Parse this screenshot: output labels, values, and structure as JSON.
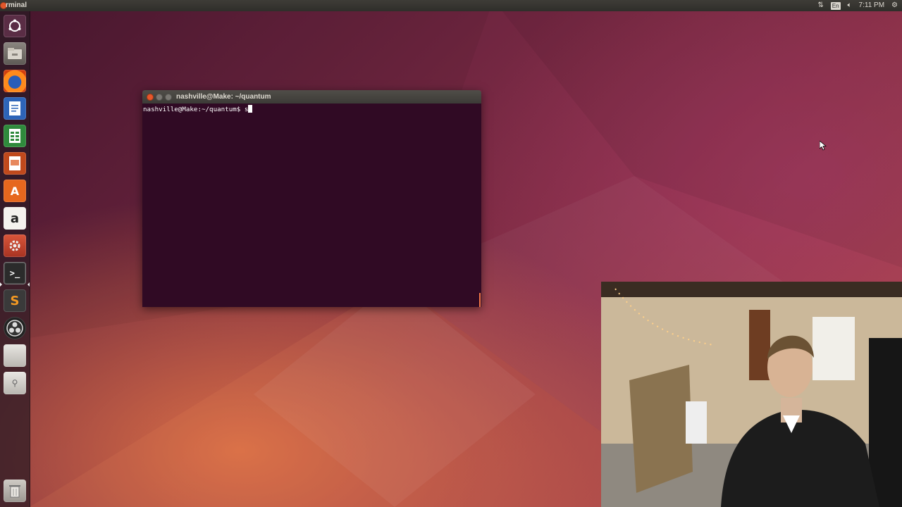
{
  "topbar": {
    "app_title": "rminal",
    "keyboard_lang": "En",
    "clock": "7:11 PM"
  },
  "launcher": {
    "items": [
      {
        "name": "dash-home-icon",
        "glyph": ""
      },
      {
        "name": "files-icon",
        "glyph": ""
      },
      {
        "name": "firefox-icon",
        "glyph": ""
      },
      {
        "name": "libreoffice-writer-icon",
        "glyph": ""
      },
      {
        "name": "libreoffice-calc-icon",
        "glyph": ""
      },
      {
        "name": "libreoffice-impress-icon",
        "glyph": ""
      },
      {
        "name": "software-center-icon",
        "glyph": "A"
      },
      {
        "name": "amazon-icon",
        "glyph": "a"
      },
      {
        "name": "system-settings-icon",
        "glyph": ""
      },
      {
        "name": "terminal-icon",
        "glyph": ">_"
      },
      {
        "name": "sublime-text-icon",
        "glyph": "S"
      },
      {
        "name": "obs-studio-icon",
        "glyph": ""
      },
      {
        "name": "drive-icon",
        "glyph": ""
      },
      {
        "name": "usb-drive-icon",
        "glyph": ""
      },
      {
        "name": "trash-icon",
        "glyph": ""
      }
    ]
  },
  "terminal": {
    "title": "nashville@Make: ~/quantum",
    "prompt": "nashville@Make:~/quantum$ ",
    "typed": "s"
  },
  "colors": {
    "terminal_bg": "#300a24",
    "accent_orange": "#e95420"
  }
}
